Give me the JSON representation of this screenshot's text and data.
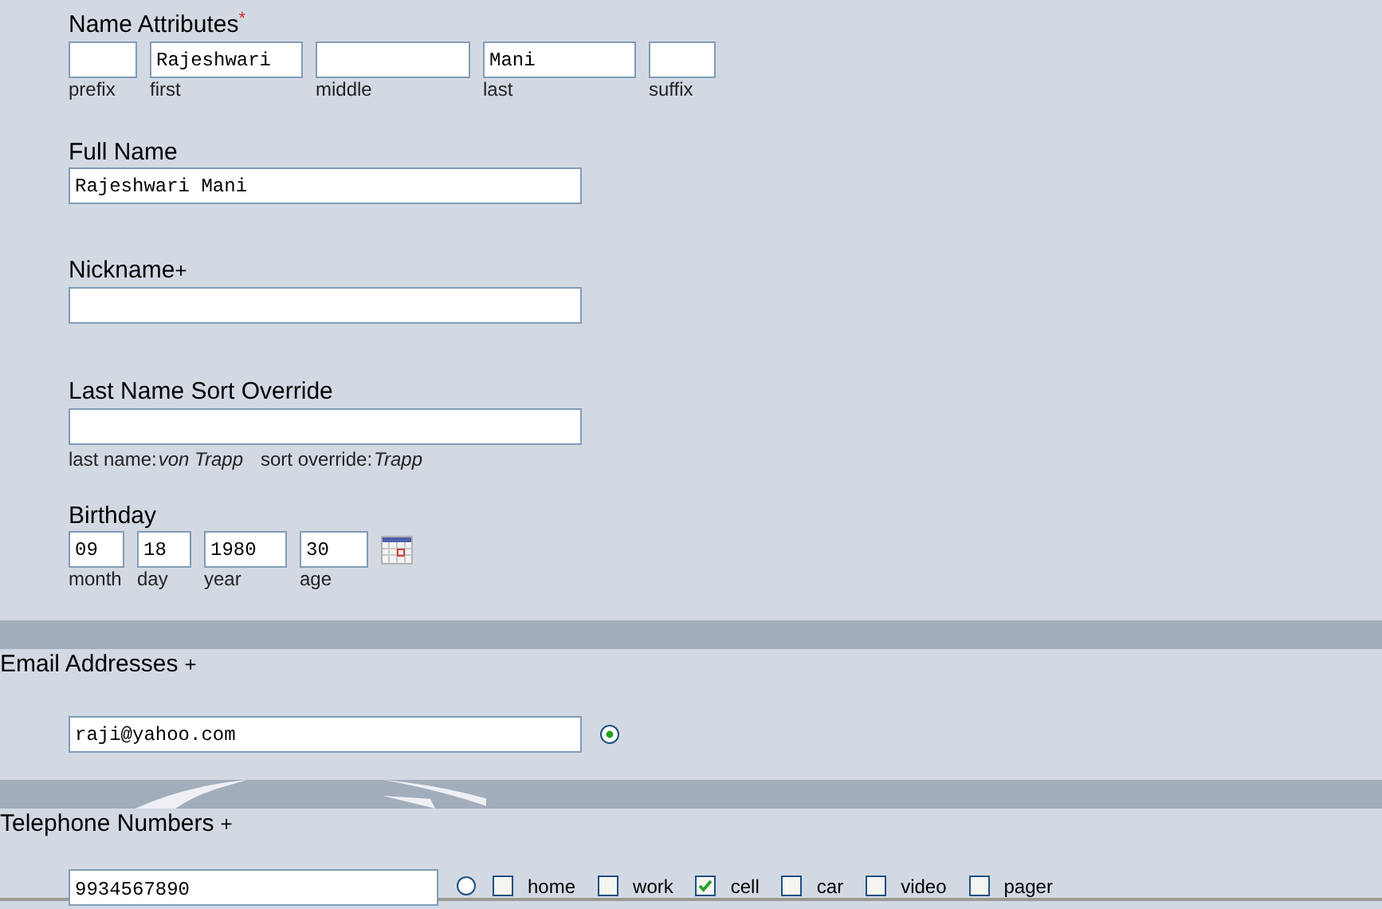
{
  "name_attributes": {
    "label": "Name Attributes",
    "required_mark": "*",
    "fields": [
      {
        "caption": "prefix"
      },
      {
        "caption": "first",
        "value": "Rajeshwari"
      },
      {
        "caption": "middle"
      },
      {
        "caption": "last",
        "value": "Mani"
      },
      {
        "caption": "suffix"
      }
    ]
  },
  "full_name": {
    "label": "Full Name",
    "value": "Rajeshwari Mani"
  },
  "nickname": {
    "label": "Nickname",
    "add": "+"
  },
  "sort_override": {
    "label": "Last Name Sort Override",
    "hint_parts": [
      {
        "text": "last name:",
        "italic": false
      },
      {
        "text": "von Trapp",
        "italic": true
      },
      {
        "text": "sort override:",
        "italic": false
      },
      {
        "text": "Trapp",
        "italic": true
      }
    ]
  },
  "birthday": {
    "label": "Birthday",
    "fields": [
      {
        "caption": "month",
        "value": "09"
      },
      {
        "caption": "day",
        "value": "18"
      },
      {
        "caption": "year",
        "value": "1980"
      },
      {
        "caption": "age",
        "value": "30"
      }
    ]
  },
  "email": {
    "label": "Email Addresses",
    "add": "+",
    "entries": [
      {
        "value": "raji@yahoo.com",
        "selected": true
      }
    ]
  },
  "phone": {
    "label": "Telephone Numbers",
    "add": "+",
    "entries": [
      {
        "value": "9934567890",
        "selected": false,
        "types": [
          {
            "label": "home",
            "checked": false
          },
          {
            "label": "work",
            "checked": false
          },
          {
            "label": "cell",
            "checked": true
          },
          {
            "label": "car",
            "checked": false
          },
          {
            "label": "video",
            "checked": false
          },
          {
            "label": "pager",
            "checked": false
          }
        ]
      }
    ]
  }
}
